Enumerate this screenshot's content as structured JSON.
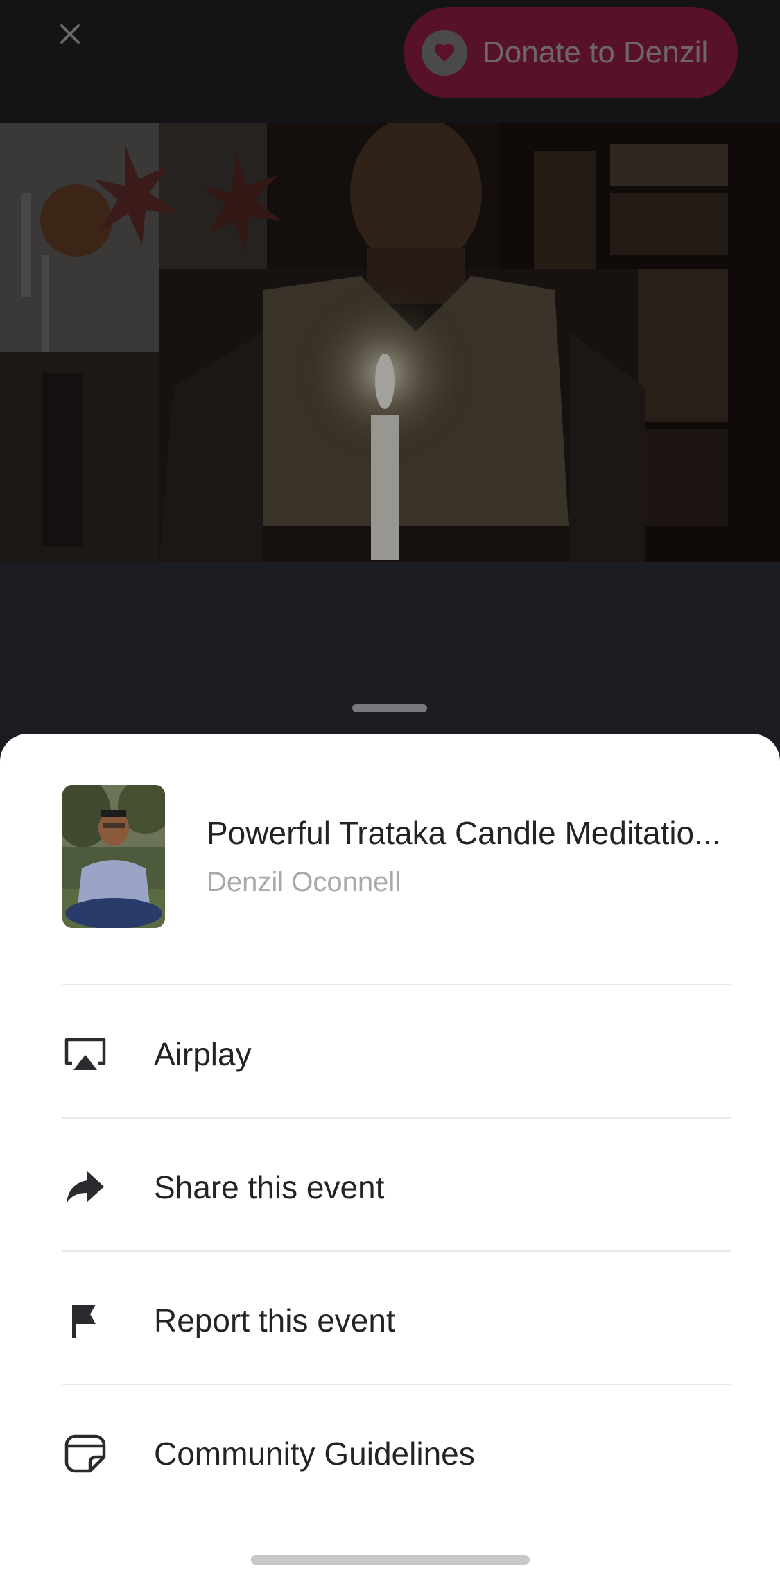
{
  "player": {
    "close_icon": "close-icon",
    "donate_label": "Donate to Denzil",
    "donate_icon": "heart-icon"
  },
  "event": {
    "title": "Powerful Trataka Candle Meditatio...",
    "host": "Denzil Oconnell"
  },
  "menu": [
    {
      "icon": "airplay-icon",
      "label": "Airplay"
    },
    {
      "icon": "share-icon",
      "label": "Share this event"
    },
    {
      "icon": "flag-icon",
      "label": "Report this event"
    },
    {
      "icon": "guidelines-icon",
      "label": "Community Guidelines"
    }
  ],
  "colors": {
    "donate_button": "#571129",
    "sheet_background": "#ffffff",
    "text_primary": "#222326",
    "text_secondary": "#a8a8ab"
  }
}
